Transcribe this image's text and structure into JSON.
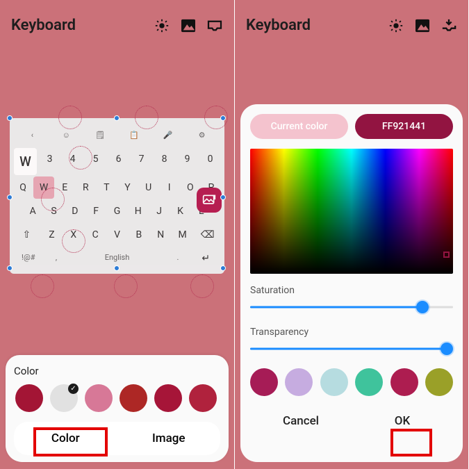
{
  "left": {
    "title": "Keyboard",
    "keyboard": {
      "row_top_icons": [
        "chevron-left",
        "smiley",
        "note",
        "copy",
        "mic",
        "gear"
      ],
      "row_w": "W",
      "row_nums": [
        "3",
        "4",
        "5",
        "6",
        "7",
        "8",
        "9",
        "0"
      ],
      "row_qwerty": [
        "Q",
        "W",
        "E",
        "R",
        "T",
        "Y",
        "U",
        "I",
        "O",
        "P"
      ],
      "row_asdf": [
        "A",
        "S",
        "D",
        "F",
        "G",
        "H",
        "J",
        "K",
        "L"
      ],
      "row_zxcv": [
        "Z",
        "X",
        "C",
        "V",
        "B",
        "N",
        "M"
      ],
      "shift": "⇧",
      "backspace": "⌫",
      "sym": "!@#",
      "lang": "English",
      "enter": "↵"
    },
    "panel_label": "Color",
    "swatches": [
      "#a31535",
      "#e1e1e1",
      "#d77897",
      "#ad2725",
      "#a61538",
      "#b0223d"
    ],
    "tab_color": "Color",
    "tab_image": "Image"
  },
  "right": {
    "title": "Keyboard",
    "chip_current": "Current color",
    "chip_hex": "FF921441",
    "chip_current_bg": "#f4c3ce",
    "chip_hex_bg": "#921441",
    "saturation_label": "Saturation",
    "transparency_label": "Transparency",
    "saturation_pos": 0.85,
    "transparency_pos": 0.97,
    "swatches": [
      "#a61c56",
      "#c6ace0",
      "#b6dce0",
      "#3fc39c",
      "#ad1d50",
      "#9aa028"
    ],
    "cancel": "Cancel",
    "ok": "OK"
  }
}
